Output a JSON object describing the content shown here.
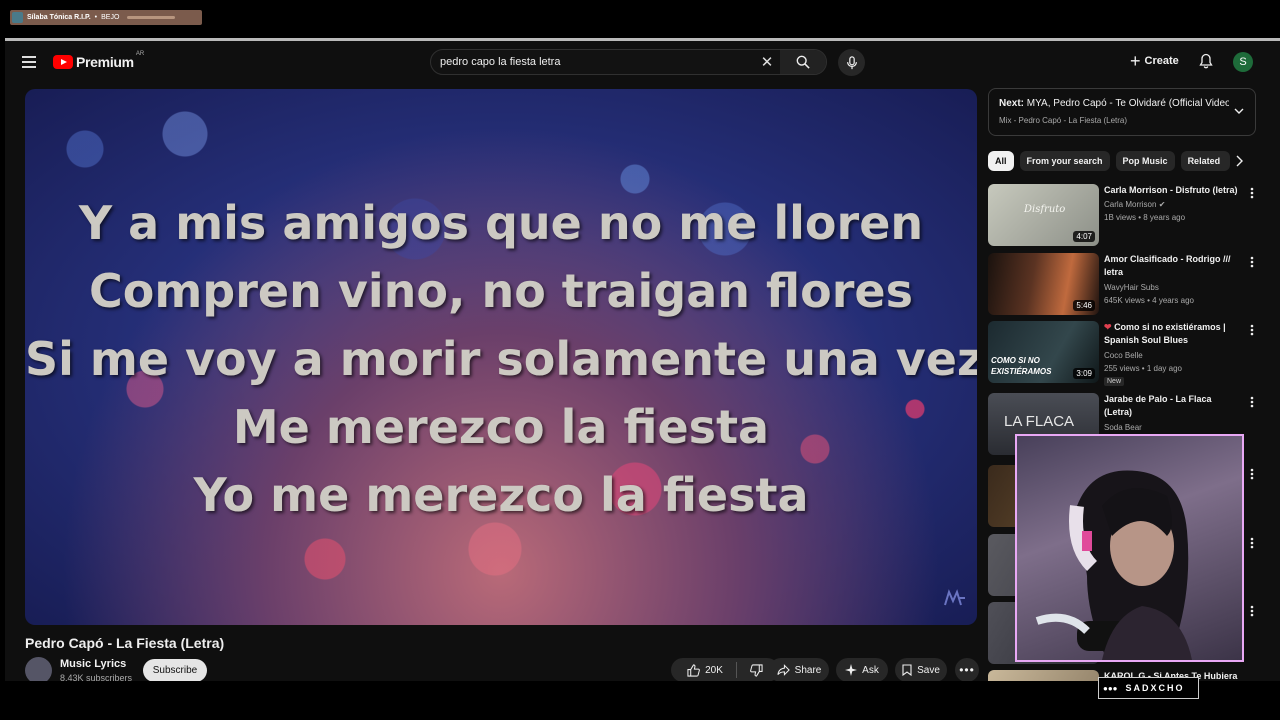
{
  "overlay": {
    "now_playing_title": "Sílaba Tónica R.I.P.",
    "now_playing_artist": "BEJO",
    "streamer_tag": "SADXCHO"
  },
  "header": {
    "logo_text": "Premium",
    "region": "AR",
    "search_value": "pedro capo la fiesta letra",
    "create_label": "Create",
    "avatar_letter": "S"
  },
  "video": {
    "lyrics": [
      "Y a mis amigos que no me lloren",
      "Compren vino, no traigan flores",
      "Si me voy a morir solamente una vez",
      "Me merezco la fiesta",
      "Yo me merezco la fiesta"
    ],
    "title": "Pedro Capó - La Fiesta (Letra)",
    "channel": "Music Lyrics",
    "subscribers": "8.43K subscribers",
    "subscribe_label": "Subscribe",
    "likes": "20K",
    "share_label": "Share",
    "ask_label": "Ask",
    "save_label": "Save"
  },
  "sidebar": {
    "next_label": "Next:",
    "next_title": "MYA, Pedro Capó - Te Olvidaré (Official Video)",
    "next_sub": "Mix - Pedro Capó - La Fiesta (Letra)",
    "chips": [
      "All",
      "From your search",
      "Pop Music",
      "Related"
    ],
    "videos": [
      {
        "title": "Carla Morrison - Disfruto (letra)",
        "channel": "Carla Morrison",
        "meta": "1B views • 8 years ago",
        "duration": "4:07",
        "thumb_text": "Disfruto"
      },
      {
        "title": "Amor Clasificado - Rodrigo /// letra",
        "channel": "WavyHair Subs",
        "meta": "645K views • 4 years ago",
        "duration": "5:46"
      },
      {
        "title": "Como si no existiéramos | Spanish Soul Blues",
        "channel": "Coco Belle",
        "meta": "255 views • 1 day ago",
        "duration": "3:09",
        "badge": "New",
        "thumb_text": "COMO SI NO EXISTIÉRAMOS"
      },
      {
        "title": "Jarabe de Palo - La Flaca (Letra)",
        "channel": "Soda Bear",
        "thumb_text": "LA FLACA"
      },
      {
        "title": "KAROL G - Si Antes Te Hubiera"
      }
    ]
  }
}
